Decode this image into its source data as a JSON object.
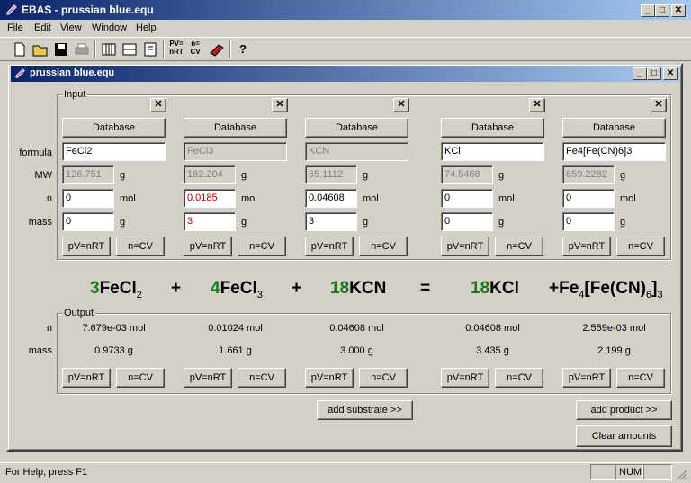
{
  "app": {
    "title": "EBAS - prussian blue.equ",
    "min": "_",
    "max": "□",
    "close": "✕"
  },
  "menu": [
    "File",
    "Edit",
    "View",
    "Window",
    "Help"
  ],
  "toolbar": {
    "pv": "PV=\nnRT",
    "ncv": "n=\nCV",
    "help": "?"
  },
  "doc": {
    "title": "prussian blue.equ",
    "min": "_",
    "max": "□",
    "close": "✕"
  },
  "input": {
    "label": "Input",
    "row_labels": {
      "formula": "formula",
      "mw": "MW",
      "n": "n",
      "mass": "mass"
    },
    "units": {
      "g": "g",
      "mol": "mol"
    },
    "buttons": {
      "database": "Database",
      "pv": "pV=nRT",
      "ncv": "n=CV",
      "remove": "✕"
    },
    "columns": [
      {
        "formula": "FeCl2",
        "mw": "126.751",
        "n": "0",
        "mass": "0",
        "formula_disabled": false,
        "n_red": false
      },
      {
        "formula": "FeCl3",
        "mw": "162.204",
        "n": "0.0185",
        "mass": "3",
        "formula_disabled": true,
        "n_red": true
      },
      {
        "formula": "KCN",
        "mw": "65.1112",
        "n": "0.04608",
        "mass": "3",
        "formula_disabled": true,
        "n_red": false
      },
      {
        "formula": "KCl",
        "mw": "74.5468",
        "n": "0",
        "mass": "0",
        "formula_disabled": false,
        "n_red": false
      },
      {
        "formula": "Fe4[Fe(CN)6]3",
        "mw": "859.2282",
        "n": "0",
        "mass": "0",
        "formula_disabled": false,
        "n_red": false
      }
    ]
  },
  "equation": {
    "plus": "+",
    "equals": "=",
    "terms": [
      {
        "coef": "3",
        "a": "FeCl",
        "s1": "2",
        "b": "",
        "s2": "",
        "c": "",
        "s3": ""
      },
      {
        "coef": "4",
        "a": "FeCl",
        "s1": "3",
        "b": "",
        "s2": "",
        "c": "",
        "s3": ""
      },
      {
        "coef": "18",
        "a": "KCN",
        "s1": "",
        "b": "",
        "s2": "",
        "c": "",
        "s3": ""
      },
      {
        "coef": "18",
        "a": "KCl",
        "s1": "",
        "b": "",
        "s2": "",
        "c": "",
        "s3": ""
      },
      {
        "coef": "",
        "a": "+Fe",
        "s1": "4",
        "b": "[Fe(CN)",
        "s2": "6",
        "c": "]",
        "s3": "3"
      }
    ]
  },
  "output": {
    "label": "Output",
    "row_labels": {
      "n": "n",
      "mass": "mass"
    },
    "columns": [
      {
        "n": "7.679e-03 mol",
        "mass": "0.9733 g"
      },
      {
        "n": "0.01024 mol",
        "mass": "1.661 g"
      },
      {
        "n": "0.04608 mol",
        "mass": "3.000 g"
      },
      {
        "n": "0.04608 mol",
        "mass": "3.435 g"
      },
      {
        "n": "2.559e-03 mol",
        "mass": "2.199 g"
      }
    ]
  },
  "actions": {
    "add_substrate": "add substrate >>",
    "add_product": "add product >>",
    "clear": "Clear amounts"
  },
  "status": {
    "help": "For Help, press F1",
    "num": "NUM"
  },
  "colors": {
    "title_start": "#0a246a",
    "title_end": "#a6caf0",
    "coef_green": "#1a7a1a",
    "red_value": "#c00000"
  }
}
